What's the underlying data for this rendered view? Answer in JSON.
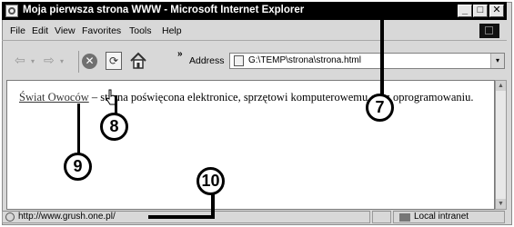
{
  "window": {
    "title": "Moja pierwsza strona WWW - Microsoft Internet Explorer",
    "controls": {
      "minimize": "_",
      "maximize": "□",
      "close": "✕"
    }
  },
  "menu": [
    "File",
    "Edit",
    "View",
    "Favorites",
    "Tools",
    "Help"
  ],
  "toolbar": {
    "icons": [
      "back-arrow-icon",
      "forward-arrow-icon",
      "stop-icon",
      "refresh-icon",
      "home-icon"
    ],
    "chevron": "»",
    "address_label": "Address",
    "address_value": "G:\\TEMP\\strona\\strona.html"
  },
  "page": {
    "link_text": "Świat Owoców",
    "body_text": " – strona poświęcona elektronice, sprzętowi komputerowemu oraz oprogramowaniu."
  },
  "status": {
    "url": "http://www.grush.one.pl/",
    "zone": "Local intranet"
  },
  "callouts": [
    "7",
    "8",
    "9",
    "10"
  ]
}
